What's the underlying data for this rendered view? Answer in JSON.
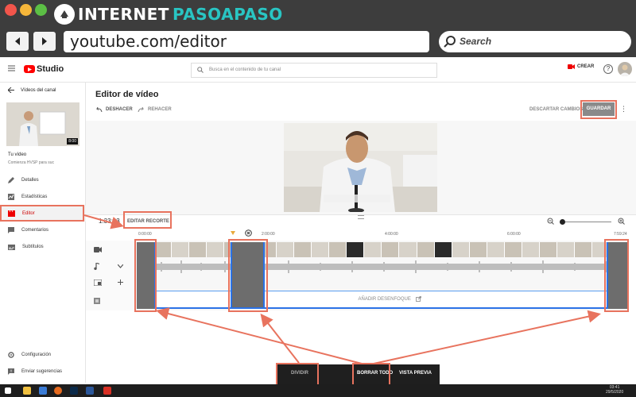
{
  "browser": {
    "brand_part1": "INTERNET",
    "brand_part2": "PASOAPASO",
    "url": "youtube.com/editor",
    "search_placeholder": "Search"
  },
  "header": {
    "logo_text": "Studio",
    "search_placeholder": "Busca en el contenido de tu canal",
    "create_label": "CREAR",
    "help_label": "?"
  },
  "sidebar": {
    "back_label": "Vídeos del canal",
    "thumb_duration": "8:00",
    "video_title": "Tu vídeo",
    "video_subtitle": "Comienza HVSP para suc",
    "items": [
      {
        "label": "Detalles"
      },
      {
        "label": "Estadísticas"
      },
      {
        "label": "Editor"
      },
      {
        "label": "Comentarios"
      },
      {
        "label": "Subtítulos"
      }
    ],
    "footer": [
      {
        "label": "Configuración"
      },
      {
        "label": "Enviar sugerencias"
      }
    ]
  },
  "editor": {
    "title": "Editor de vídeo",
    "undo_label": "DESHACER",
    "redo_label": "REHACER",
    "discard_label": "DESCARTAR CAMBIOS",
    "save_label": "GUARDAR",
    "timecode": "1:33:23",
    "trim_label": "EDITAR RECORTE",
    "ruler": [
      "0:00:00",
      "2:00:00",
      "4:00:00",
      "6:00:00",
      "7:59:24"
    ],
    "blur_label": "AÑADIR DESENFOQUE"
  },
  "actions": {
    "split_label": "DIVIDIR",
    "clear_label": "BORRAR TODO",
    "preview_label": "VISTA PREVIA"
  },
  "taskbar": {
    "time": "03:41",
    "date": "29/5/2020"
  },
  "colors": {
    "accent_red": "#ff0000",
    "annotation": "#e8735e",
    "selection_blue": "#2b72e6",
    "brand_teal": "#29c5c3"
  }
}
